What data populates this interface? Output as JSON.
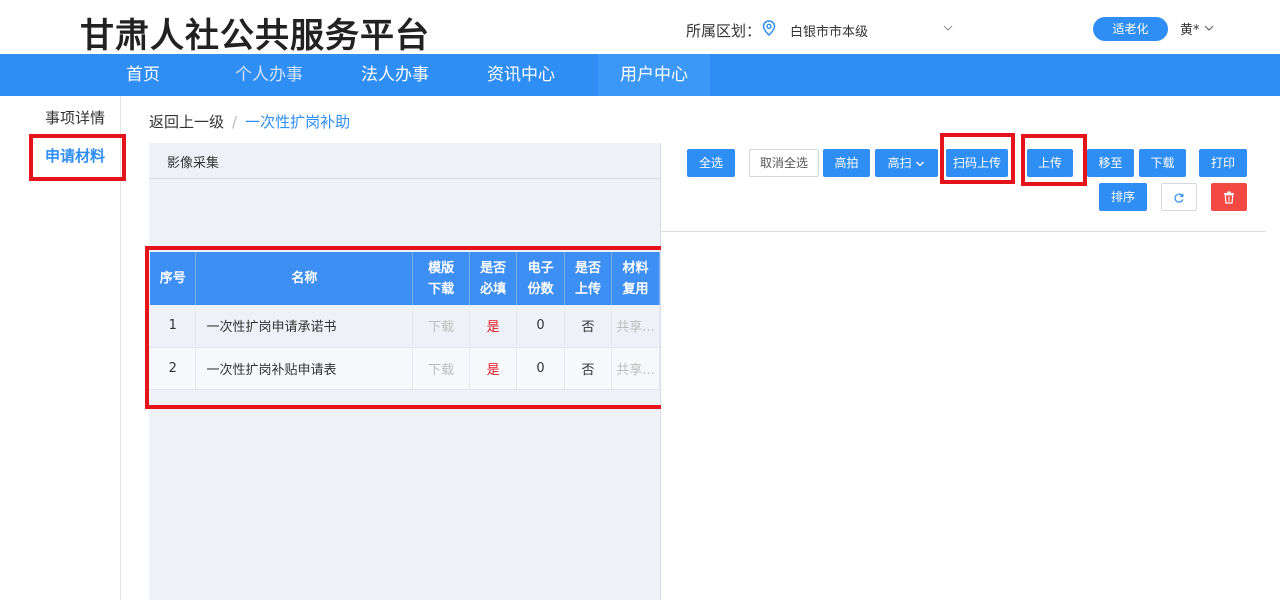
{
  "header": {
    "title": "甘肃人社公共服务平台",
    "region_label": "所属区划：",
    "region_value": "白银市市本级",
    "elder_mode": "适老化",
    "user": "黄*"
  },
  "nav": {
    "items": [
      "首页",
      "个人办事",
      "法人办事",
      "资讯中心",
      "用户中心"
    ]
  },
  "sidebar": {
    "items": [
      "事项详情",
      "申请材料"
    ]
  },
  "breadcrumb": {
    "back": "返回上一级",
    "separator": "/",
    "current": "一次性扩岗补助"
  },
  "left_panel": {
    "title": "影像采集"
  },
  "table": {
    "headers": {
      "seq": "序号",
      "name": "名称",
      "template_1": "模版",
      "template_2": "下载",
      "required_1": "是否",
      "required_2": "必填",
      "copies_1": "电子",
      "copies_2": "份数",
      "uploaded_1": "是否",
      "uploaded_2": "上传",
      "reuse_1": "材料",
      "reuse_2": "复用"
    },
    "rows": [
      {
        "seq": "1",
        "name": "一次性扩岗申请承诺书",
        "download": "下载",
        "required": "是",
        "copies": "0",
        "uploaded": "否",
        "reuse": "共享..."
      },
      {
        "seq": "2",
        "name": "一次性扩岗补贴申请表",
        "download": "下载",
        "required": "是",
        "copies": "0",
        "uploaded": "否",
        "reuse": "共享..."
      }
    ]
  },
  "toolbar": {
    "select_all": "全选",
    "deselect_all": "取消全选",
    "high_shot": "高拍",
    "high_scan": "高扫",
    "scan_upload": "扫码上传",
    "upload": "上传",
    "move_to": "移至",
    "download": "下载",
    "print": "打印",
    "sort": "排序"
  },
  "colors": {
    "accent": "#2f8ef4",
    "highlight": "#e5141b",
    "danger": "#f24a42"
  }
}
